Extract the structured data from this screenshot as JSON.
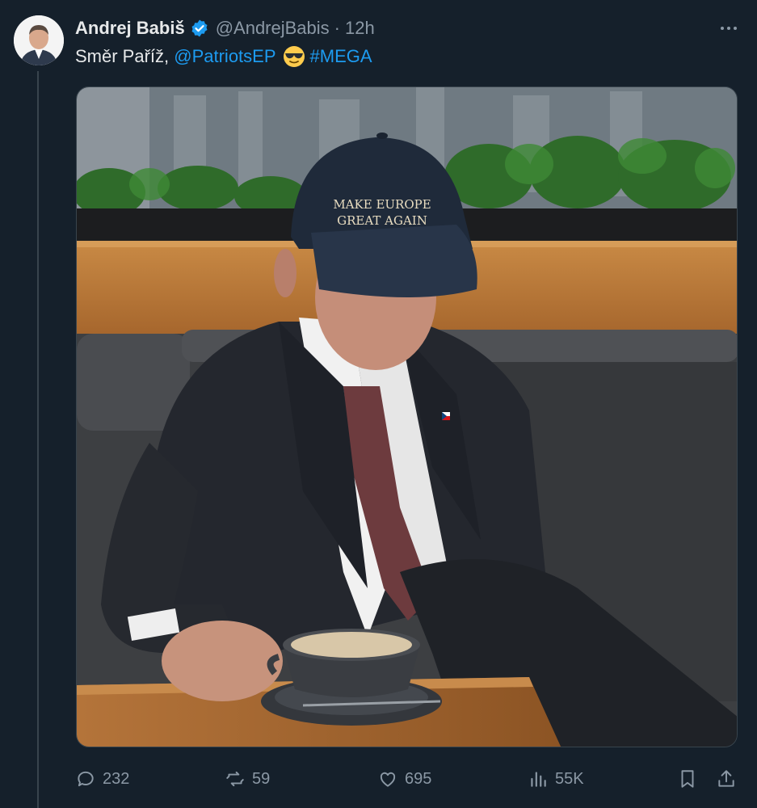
{
  "tweet": {
    "author_name": "Andrej Babiš",
    "handle": "@AndrejBabis",
    "separator": "·",
    "time": "12h",
    "verified": true,
    "text_parts": {
      "prefix": "Směr Paříž, ",
      "mention": "@PatriotsEP",
      "emoji": "😎",
      "hashtag": "#MEGA"
    },
    "media": {
      "cap_text_line1": "MAKE EUROPE",
      "cap_text_line2": "GREAT AGAIN"
    }
  },
  "actions": {
    "replies": "232",
    "reposts": "59",
    "likes": "695",
    "views": "55K"
  },
  "colors": {
    "background": "#15202b",
    "accent": "#1d9bf0",
    "secondary_text": "#8b98a5",
    "primary_text": "#e7e9ea"
  },
  "icons": [
    "reply-icon",
    "repost-icon",
    "like-icon",
    "views-icon",
    "bookmark-icon",
    "share-icon",
    "verified-icon",
    "more-icon"
  ]
}
